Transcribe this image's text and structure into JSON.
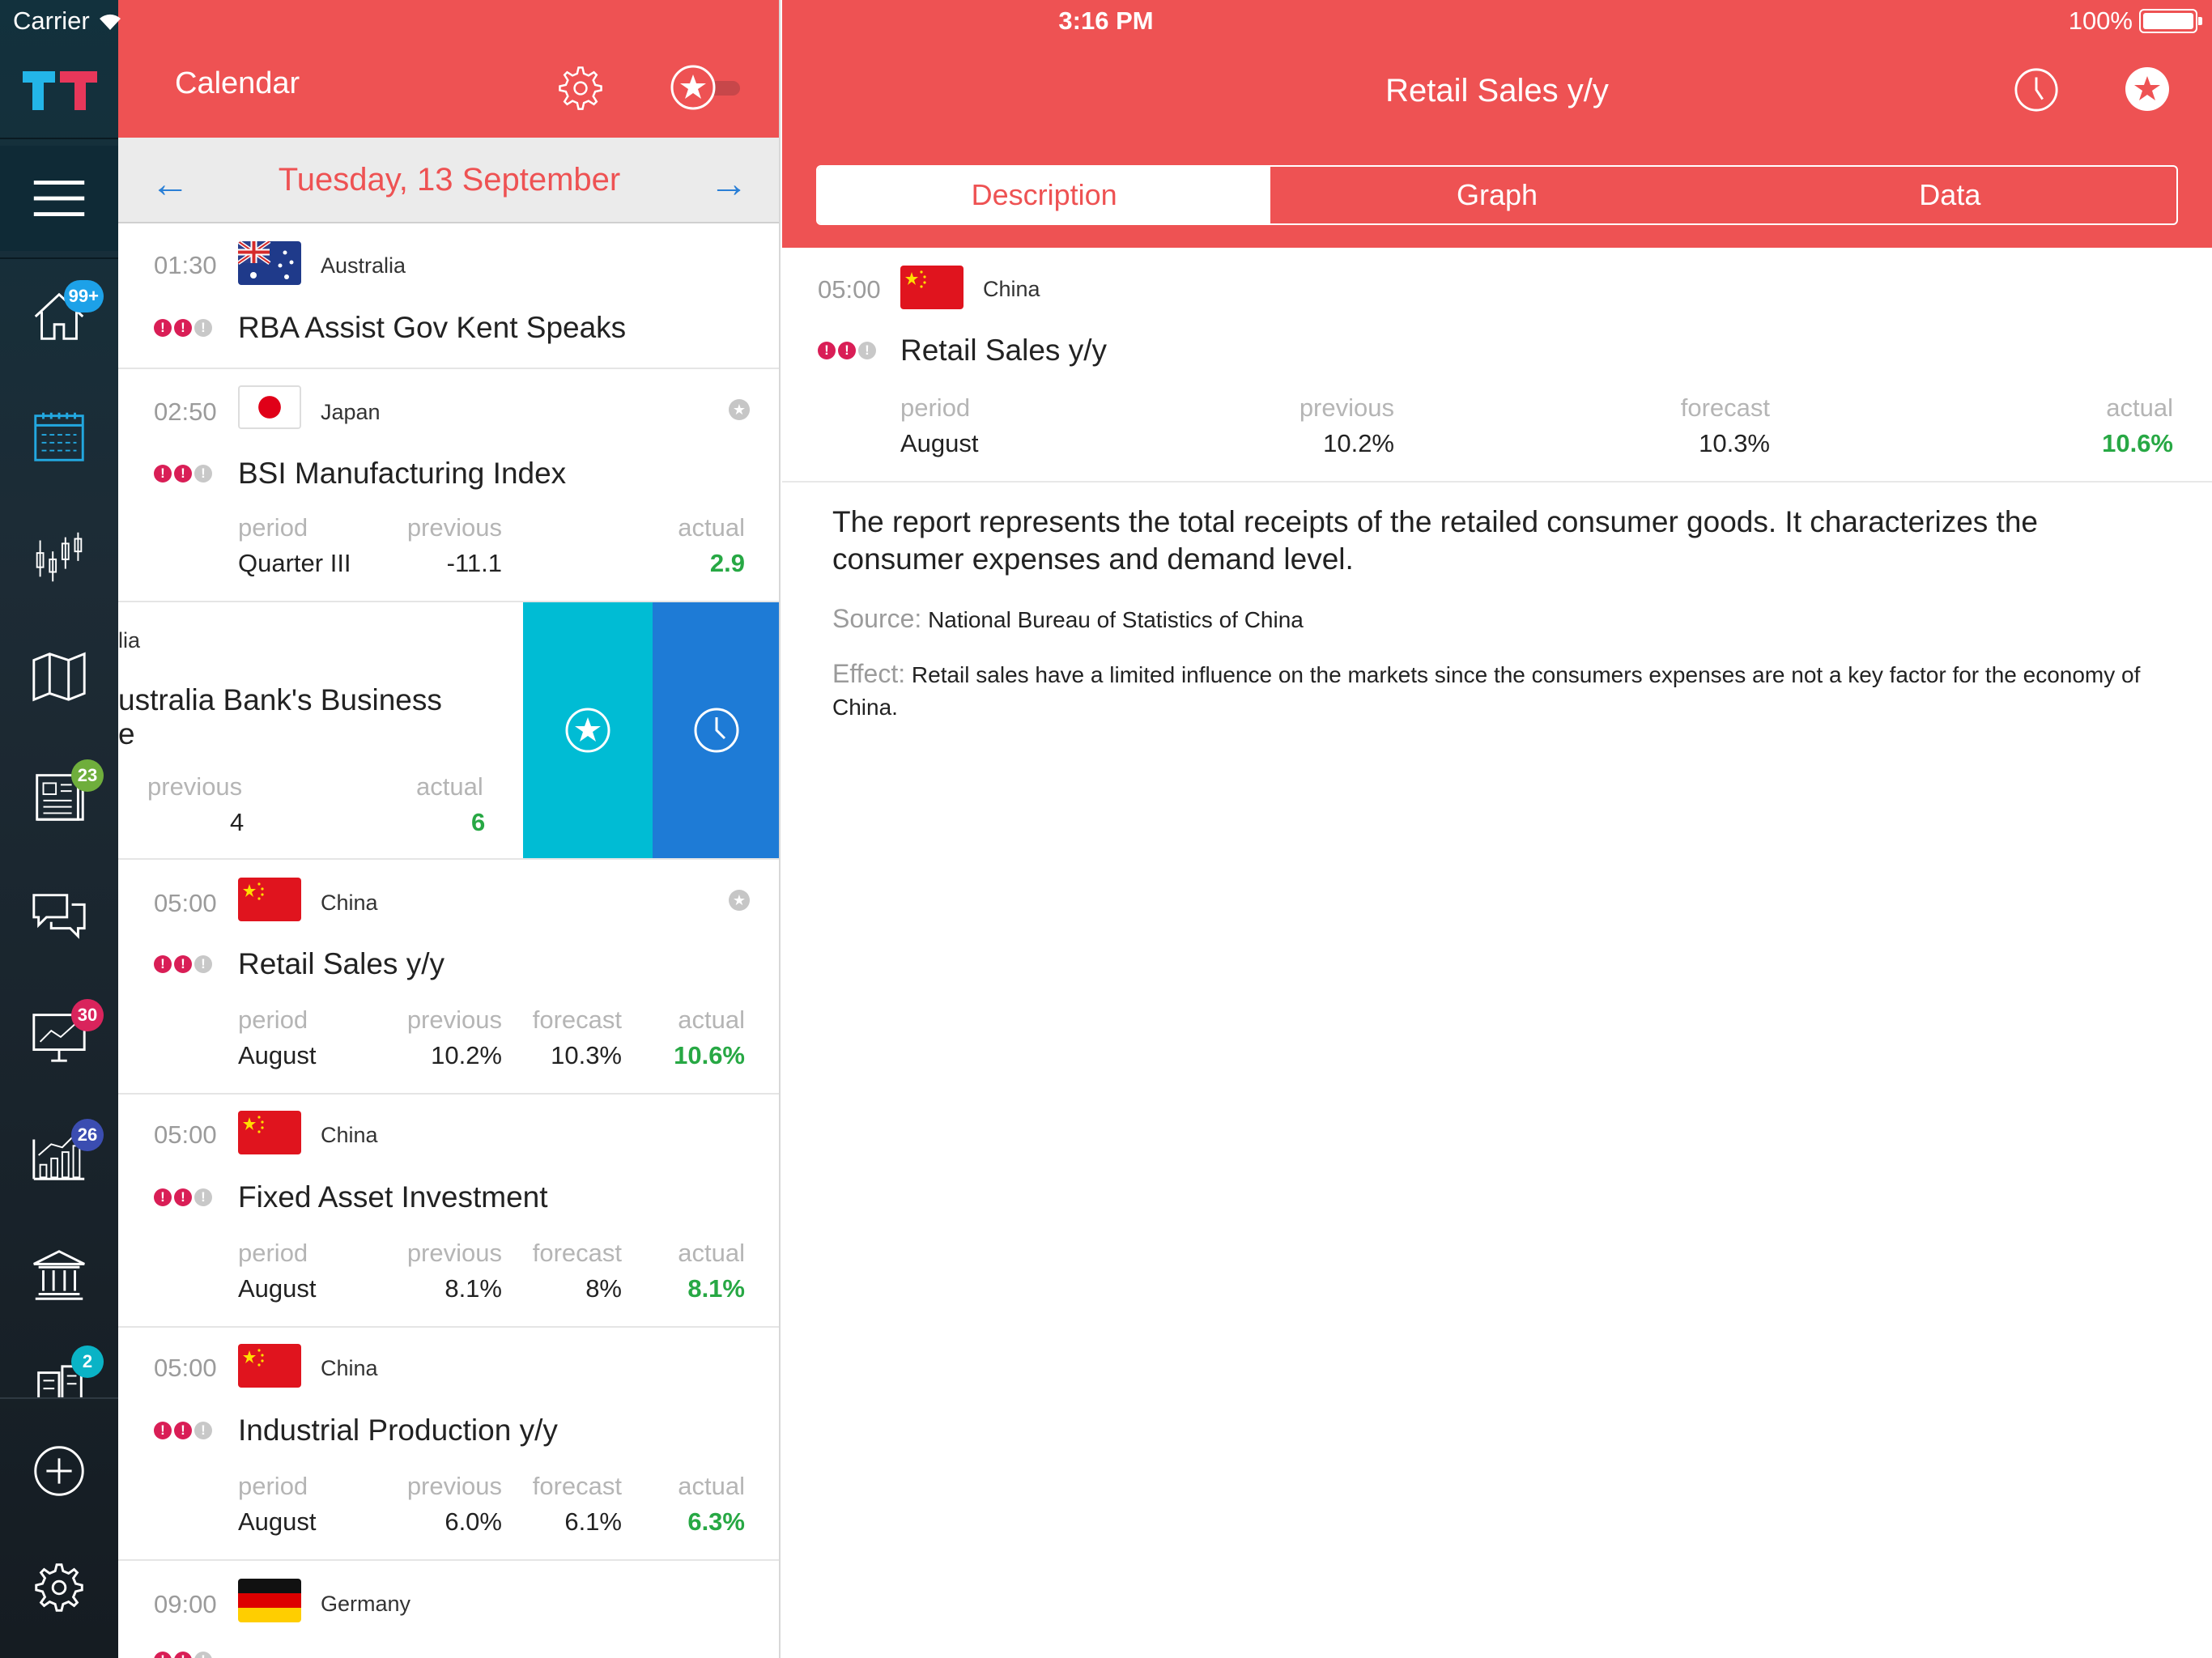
{
  "status_bar": {
    "carrier": "Carrier",
    "time": "3:16 PM",
    "battery": "100%"
  },
  "sidebar": {
    "badges": {
      "home": "99+",
      "news": "23",
      "ideas": "30",
      "stats": "26",
      "brokers": "2"
    }
  },
  "calendar": {
    "title": "Calendar",
    "date": "Tuesday, 13 September",
    "events": [
      {
        "time": "01:30",
        "country": "Australia",
        "name": "RBA Assist Gov Kent Speaks",
        "importance": 2
      },
      {
        "time": "02:50",
        "country": "Japan",
        "name": "BSI Manufacturing Index",
        "importance": 2,
        "period_label": "period",
        "previous_label": "previous",
        "actual_label": "actual",
        "period": "Quarter III",
        "previous": "-11.1",
        "actual": "2.9"
      },
      {
        "country": "lia",
        "name_line1": "ustralia Bank's Business",
        "name_line2": "e",
        "previous_label": "previous",
        "actual_label": "actual",
        "previous": "4",
        "actual": "6"
      },
      {
        "time": "05:00",
        "country": "China",
        "name": "Retail Sales y/y",
        "importance": 2,
        "period_label": "period",
        "previous_label": "previous",
        "forecast_label": "forecast",
        "actual_label": "actual",
        "period": "August",
        "previous": "10.2%",
        "forecast": "10.3%",
        "actual": "10.6%"
      },
      {
        "time": "05:00",
        "country": "China",
        "name": "Fixed Asset Investment",
        "importance": 2,
        "period_label": "period",
        "previous_label": "previous",
        "forecast_label": "forecast",
        "actual_label": "actual",
        "period": "August",
        "previous": "8.1%",
        "forecast": "8%",
        "actual": "8.1%"
      },
      {
        "time": "05:00",
        "country": "China",
        "name": "Industrial Production y/y",
        "importance": 2,
        "period_label": "period",
        "previous_label": "previous",
        "forecast_label": "forecast",
        "actual_label": "actual",
        "period": "August",
        "previous": "6.0%",
        "forecast": "6.1%",
        "actual": "6.3%"
      },
      {
        "time": "09:00",
        "country": "Germany"
      }
    ]
  },
  "detail": {
    "title": "Retail Sales y/y",
    "tabs": [
      "Description",
      "Graph",
      "Data"
    ],
    "time": "05:00",
    "country": "China",
    "name": "Retail Sales y/y",
    "labels": {
      "period": "period",
      "previous": "previous",
      "forecast": "forecast",
      "actual": "actual"
    },
    "period": "August",
    "previous": "10.2%",
    "forecast": "10.3%",
    "actual": "10.6%",
    "description": "The report represents the total receipts of the retailed consumer goods. It characterizes the consumer expenses and demand level.",
    "source_label": "Source:",
    "source": "National Bureau of Statistics of China",
    "effect_label": "Effect:",
    "effect": "Retail sales have a limited influence on the markets since the consumers expenses are not a key factor for the economy of China."
  },
  "colors": {
    "accent": "#ee5253",
    "actual": "#27a844",
    "importance": "#d91e56",
    "swipe_favorite": "#00bcd4",
    "swipe_reminder": "#1e7bd6"
  }
}
